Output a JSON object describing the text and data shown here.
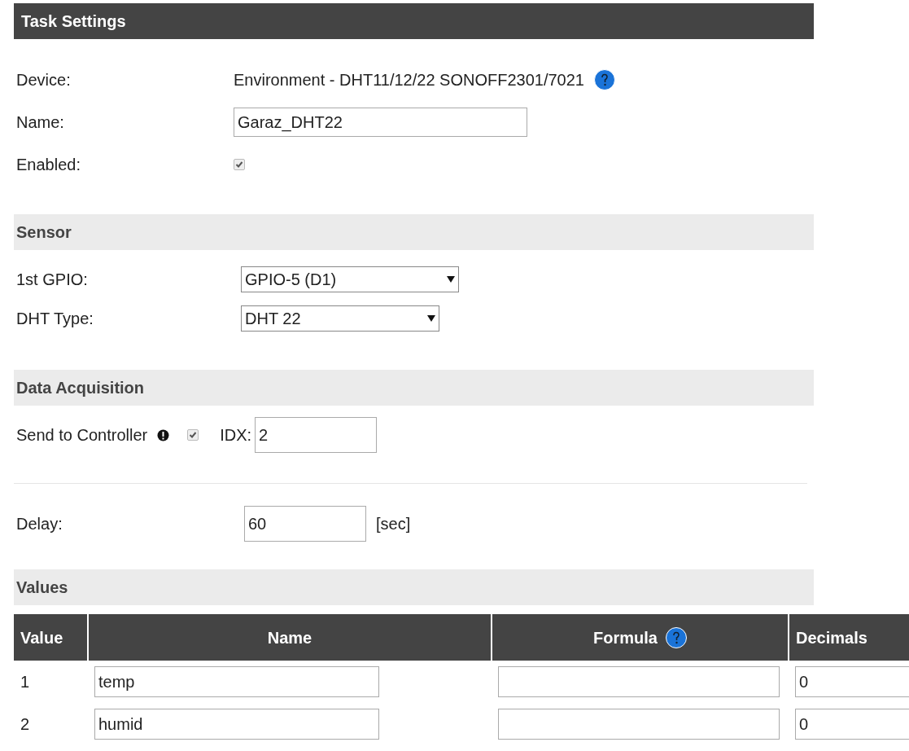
{
  "title": "Task Settings",
  "device": {
    "label": "Device:",
    "value": "Environment - DHT11/12/22 SONOFF2301/7021"
  },
  "name": {
    "label": "Name:",
    "value": "Garaz_DHT22"
  },
  "enabled": {
    "label": "Enabled:",
    "checked": true
  },
  "sensor": {
    "title": "Sensor",
    "fields": [
      {
        "label": "1st GPIO:",
        "value": "GPIO-5 (D1)"
      },
      {
        "label": "DHT Type:",
        "value": "DHT 22"
      }
    ]
  },
  "acquisition": {
    "title": "Data Acquisition",
    "send_label": "Send to Controller",
    "send_checked": true,
    "idx_label": "IDX:",
    "idx_value": "2",
    "delay_label": "Delay:",
    "delay_value": "60",
    "delay_unit": "[sec]"
  },
  "values": {
    "title": "Values",
    "columns": [
      "Value",
      "Name",
      "Formula",
      "Decimals"
    ],
    "rows": [
      {
        "value": "1",
        "name": "temp",
        "decimals": "0"
      },
      {
        "value": "2",
        "name": "humid",
        "decimals": "0"
      }
    ]
  }
}
